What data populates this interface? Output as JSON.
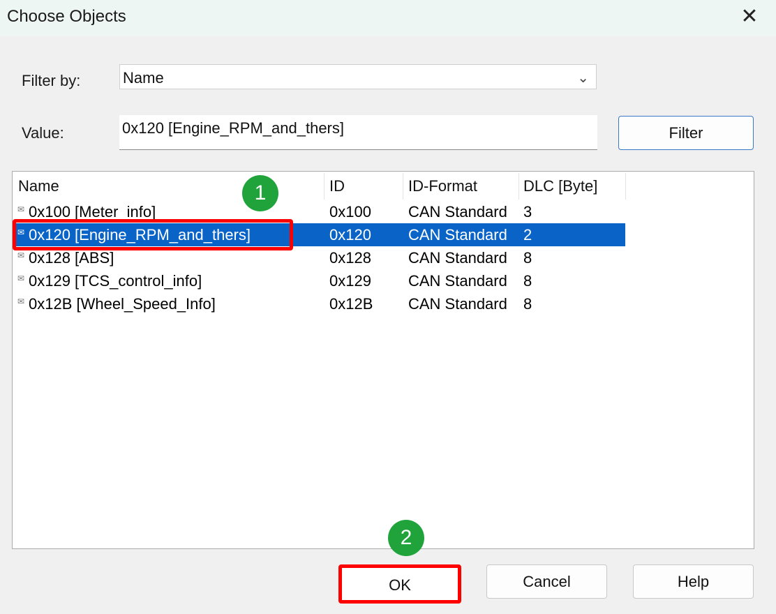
{
  "window": {
    "title": "Choose Objects",
    "close_icon": "close-icon"
  },
  "filter": {
    "label": "Filter by:",
    "selected": "Name",
    "value_label": "Value:",
    "value": "0x120 [Engine_RPM_and_thers]",
    "button": "Filter"
  },
  "list": {
    "columns": [
      "Name",
      "ID",
      "ID-Format",
      "DLC [Byte]"
    ],
    "rows": [
      {
        "name": "0x100 [Meter_info]",
        "id": "0x100",
        "format": "CAN Standard",
        "dlc": "3"
      },
      {
        "name": "0x120 [Engine_RPM_and_thers]",
        "id": "0x120",
        "format": "CAN Standard",
        "dlc": "2",
        "selected": true
      },
      {
        "name": "0x128 [ABS]",
        "id": "0x128",
        "format": "CAN Standard",
        "dlc": "8"
      },
      {
        "name": "0x129 [TCS_control_info]",
        "id": "0x129",
        "format": "CAN Standard",
        "dlc": "8"
      },
      {
        "name": "0x12B [Wheel_Speed_Info]",
        "id": "0x12B",
        "format": "CAN Standard",
        "dlc": "8"
      }
    ]
  },
  "annotations": {
    "step1": "1",
    "step2": "2",
    "highlight_color": "#ff0000",
    "badge_color": "#1fa33a"
  },
  "buttons": {
    "ok": "OK",
    "cancel": "Cancel",
    "help": "Help"
  },
  "colors": {
    "selection": "#0a64c8"
  }
}
